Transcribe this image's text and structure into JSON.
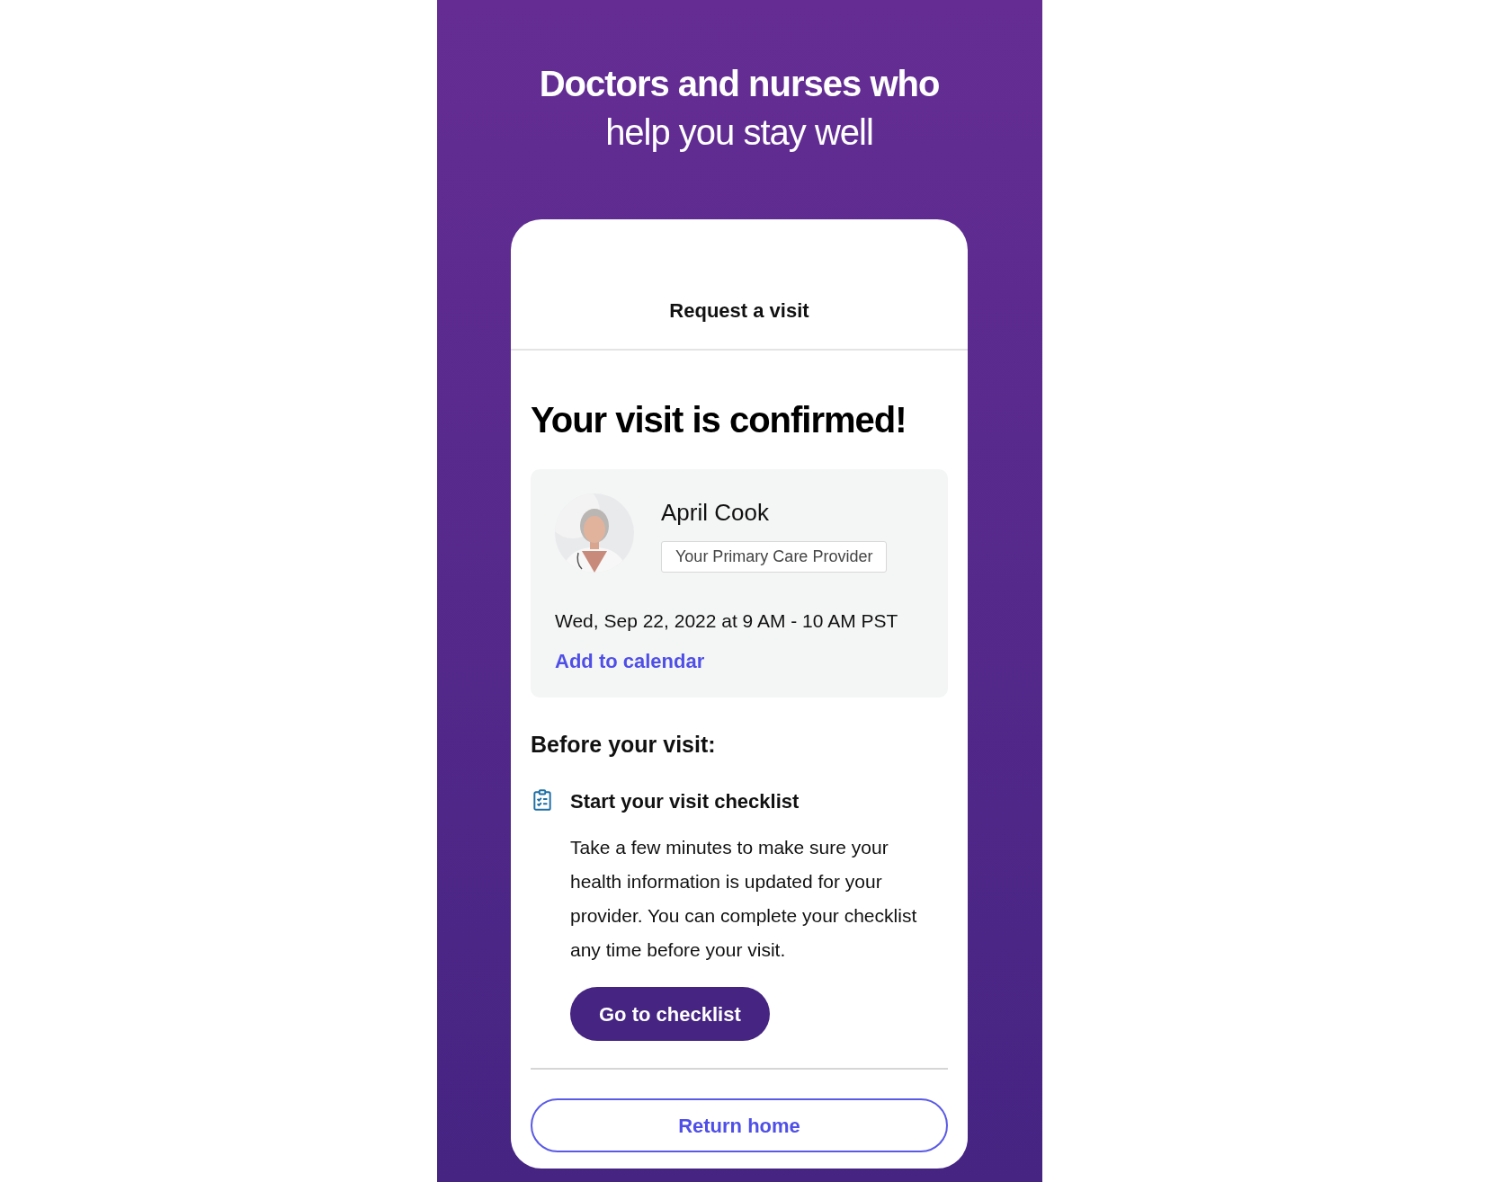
{
  "header": {
    "title_bold": "Doctors and nurses who",
    "title_regular": "help you stay well"
  },
  "card": {
    "nav_title": "Request a visit",
    "heading": "Your visit is confirmed!",
    "provider": {
      "name": "April Cook",
      "tag": "Your Primary Care Provider",
      "time": "Wed, Sep 22, 2022 at 9 AM - 10 AM PST",
      "link": "Add to calendar"
    },
    "section_title": "Before your visit:",
    "task": {
      "title": "Start your visit checklist",
      "description": "Take a few minutes to make sure your health information is updated for your provider. You can complete your checklist any time before your visit.",
      "button": "Go to checklist"
    },
    "footer_button": "Return home"
  }
}
